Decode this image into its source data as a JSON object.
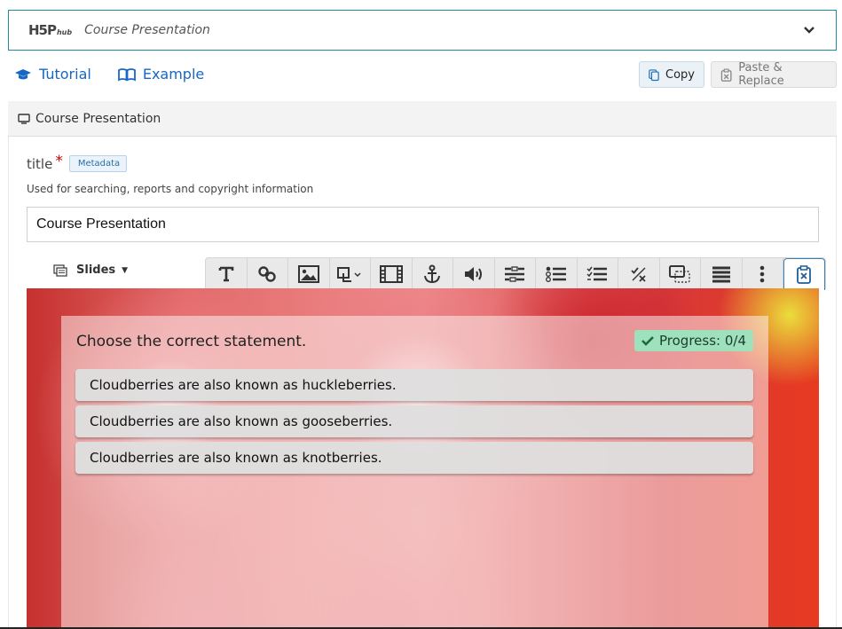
{
  "hub": {
    "logo": "H5P",
    "logo_suffix": "hub",
    "title": "Course Presentation"
  },
  "links": {
    "tutorial": "Tutorial",
    "example": "Example"
  },
  "actions": {
    "copy": "Copy",
    "paste_replace": "Paste & Replace"
  },
  "section": {
    "title": "Course Presentation"
  },
  "title_field": {
    "label": "title",
    "required_mark": "*",
    "metadata_button": "Metadata",
    "description": "Used for searching, reports and copyright information",
    "value": "Course Presentation"
  },
  "slides_menu": {
    "label": "Slides"
  },
  "toolbar": {
    "tools": [
      "text-icon",
      "link-icon",
      "image-icon",
      "shapes-icon",
      "video-icon",
      "go-to-slide-icon",
      "audio-icon",
      "fill-in-blanks-icon",
      "single-choice-set-icon",
      "multiple-choice-icon",
      "true-false-icon",
      "interactive-summary-icon",
      "table-icon",
      "more-icon",
      "paste-icon"
    ]
  },
  "slide": {
    "question": "Choose the correct statement.",
    "progress": "Progress: 0/4",
    "answers": [
      "Cloudberries are also known as huckleberries.",
      "Cloudberries are also known as gooseberries.",
      "Cloudberries are also known as knotberries."
    ]
  }
}
